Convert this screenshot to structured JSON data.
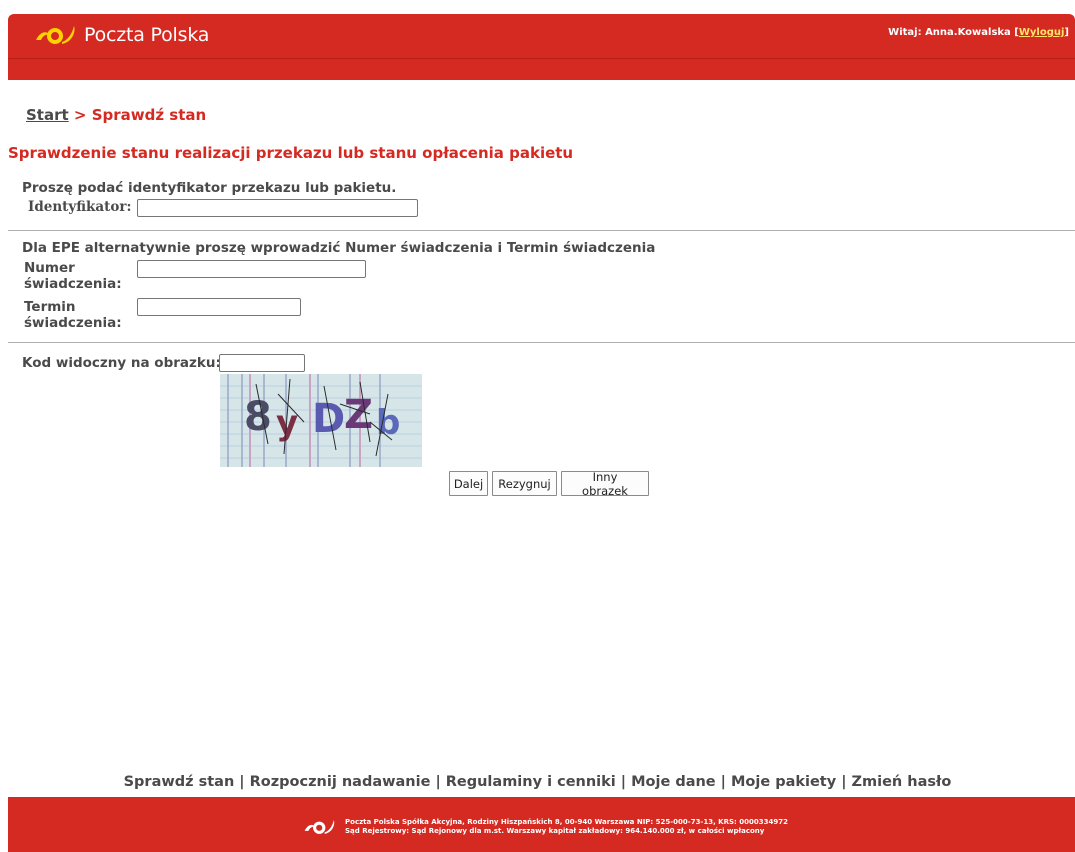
{
  "header": {
    "brand": "Poczta Polska",
    "welcome_prefix": "Witaj: Anna.Kowalska [",
    "logout_label": "Wyloguj",
    "welcome_suffix": "]"
  },
  "breadcrumb": {
    "start_label": "Start",
    "separator": " > ",
    "current": "Sprawdź stan"
  },
  "page": {
    "title": "Sprawdzenie stanu realizacji przekazu lub stanu opłacenia pakietu",
    "prompt_identifier": "Proszę podać identyfikator przekazu lub pakietu.",
    "identifier_label": "Identyfikator:",
    "identifier_value": "",
    "prompt_epe": "Dla EPE alternatywnie proszę wprowadzić Numer świadczenia i Termin świadczenia",
    "numer_label_1": "Numer",
    "numer_label_2": "świadczenia:",
    "numer_value": "",
    "termin_label_1": "Termin",
    "termin_label_2": "świadczenia:",
    "termin_value": "",
    "code_label": "Kod widoczny na obrazku:",
    "code_value": "",
    "captcha_text": "8yDZb"
  },
  "buttons": {
    "next": "Dalej",
    "cancel": "Rezygnuj",
    "other_image": "Inny obrazek"
  },
  "footer_nav": [
    "Sprawdź stan",
    "Rozpocznij nadawanie",
    "Regulaminy i cenniki",
    "Moje dane",
    "Moje pakiety",
    "Zmień hasło"
  ],
  "footer": {
    "line1": "Poczta Polska Spółka Akcyjna, Rodziny Hiszpańskich 8, 00-940 Warszawa NIP: 525-000-73-13, KRS: 0000334972",
    "line2": "Sąd Rejestrowy: Sąd Rejonowy dla m.st. Warszawy kapitał zakładowy: 964.140.000 zł, w całości wpłacony"
  },
  "colors": {
    "brand_red": "#d42a22",
    "brand_yellow": "#ffd200",
    "text_gray": "#4a4a4a"
  }
}
